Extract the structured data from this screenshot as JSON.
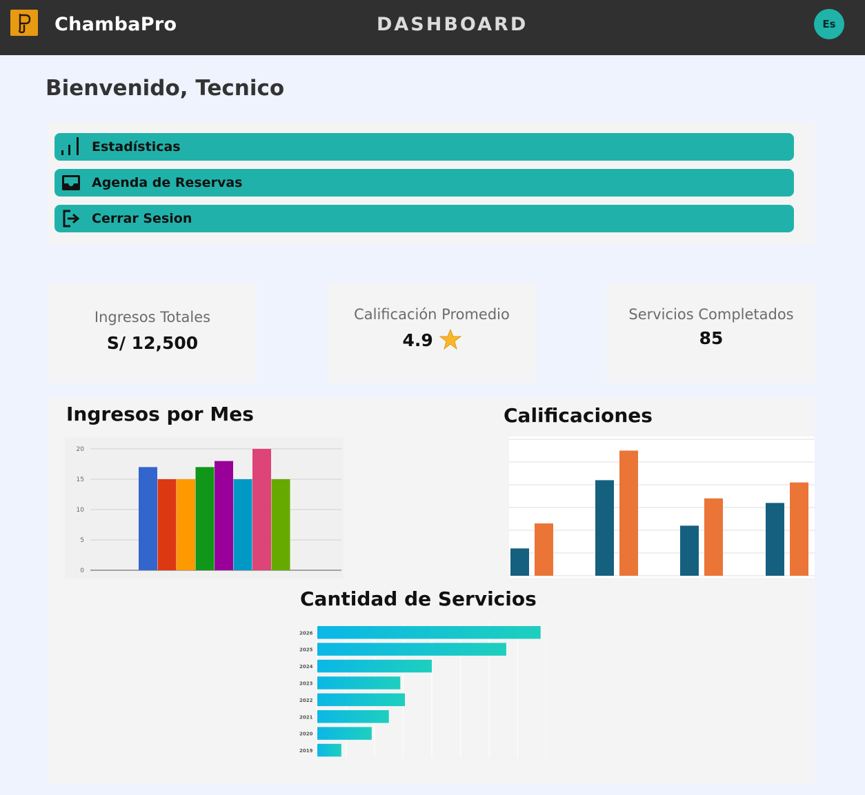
{
  "header": {
    "brand": "ChambaPro",
    "title": "DASHBOARD",
    "avatar_initials": "Es"
  },
  "welcome": "Bienvenido, Tecnico",
  "menu": [
    {
      "label": "Estadísticas",
      "icon": "bar-chart-icon"
    },
    {
      "label": "Agenda de Reservas",
      "icon": "inbox-icon"
    },
    {
      "label": "Cerrar Sesion",
      "icon": "logout-icon"
    }
  ],
  "stats": [
    {
      "label": "Ingresos Totales",
      "value": "S/ 12,500"
    },
    {
      "label": "Calificación Promedio",
      "value": "4.9",
      "icon": "star-icon"
    },
    {
      "label": "Servicios Completados",
      "value": "85"
    }
  ],
  "colors": {
    "accent": "#20b2aa",
    "header_bg": "#303030",
    "page_bg": "#eef3fe",
    "logo": "#e79a12"
  },
  "chart_data": [
    {
      "type": "bar",
      "title": "Ingresos por Mes",
      "values": [
        17,
        15,
        15,
        17,
        18,
        15,
        20,
        15
      ],
      "colors": [
        "#3366cc",
        "#dc3912",
        "#ff9900",
        "#109618",
        "#990099",
        "#0099c6",
        "#dd4477",
        "#66aa00"
      ],
      "yticks": [
        "0",
        "5",
        "10",
        "15",
        "20"
      ],
      "ylim": [
        0,
        20
      ],
      "grid": true
    },
    {
      "type": "bar",
      "title": "Calificaciones",
      "series": [
        {
          "values": [
            1.2,
            4.2,
            2.2,
            3.2
          ],
          "color": "#16607f"
        },
        {
          "values": [
            2.3,
            5.5,
            3.4,
            4.1
          ],
          "color": "#ea7537"
        }
      ],
      "ylim": [
        0,
        6
      ],
      "grid": true
    },
    {
      "type": "bar",
      "orientation": "horizontal",
      "title": "Cantidad de Servicios",
      "categories": [
        "2026",
        "2025",
        "2024",
        "2023",
        "2022",
        "2021",
        "2020",
        "2019"
      ],
      "values": [
        39,
        33,
        20,
        14.5,
        15.3,
        12.5,
        9.5,
        4.2
      ],
      "xlim": [
        0,
        40
      ],
      "gradient": [
        "#0bb7e6",
        "#1ecfbe"
      ],
      "grid": true
    }
  ]
}
